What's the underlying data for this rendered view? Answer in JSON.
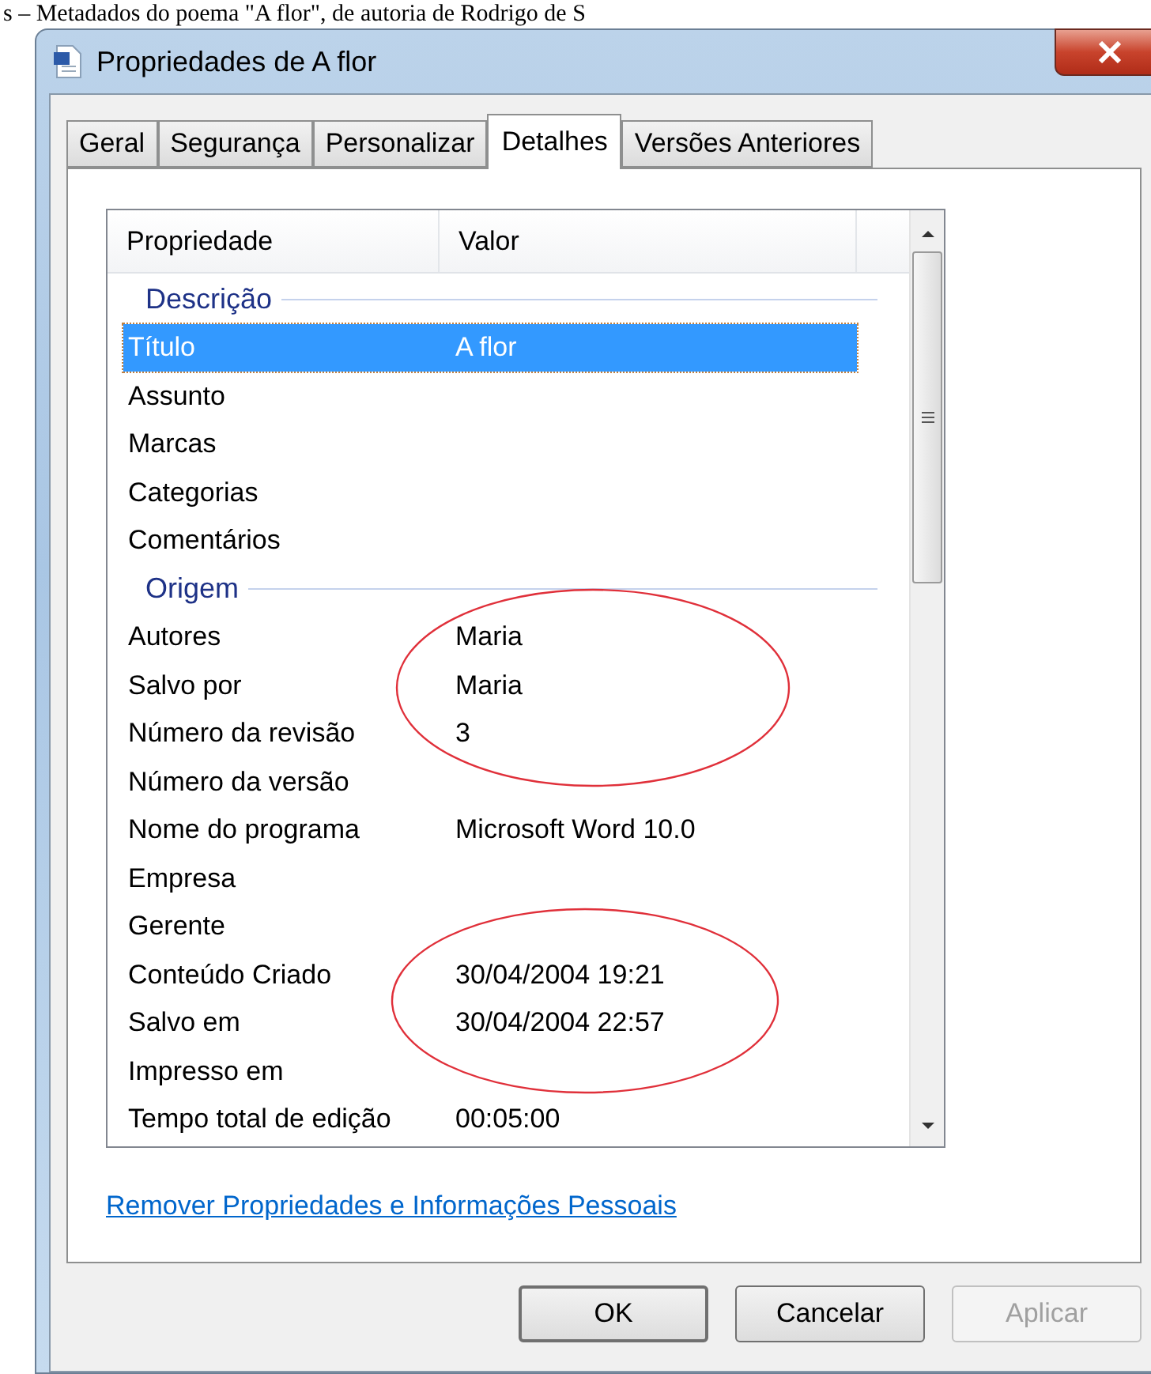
{
  "caption": "s – Metadados do poema \"A flor\", de autoria de Rodrigo de S",
  "window": {
    "title": "Propriedades de A flor"
  },
  "tabs": [
    {
      "label": "Geral",
      "selected": false
    },
    {
      "label": "Segurança",
      "selected": false
    },
    {
      "label": "Personalizar",
      "selected": false
    },
    {
      "label": "Detalhes",
      "selected": true
    },
    {
      "label": "Versões Anteriores",
      "selected": false
    }
  ],
  "table": {
    "columns": [
      "Propriedade",
      "Valor"
    ],
    "rows": [
      {
        "kind": "group",
        "label": "Descrição"
      },
      {
        "kind": "row",
        "property": "Título",
        "value": "A flor",
        "selected": true
      },
      {
        "kind": "row",
        "property": "Assunto",
        "selected": false
      },
      {
        "kind": "row",
        "property": "Marcas",
        "selected": false
      },
      {
        "kind": "row",
        "property": "Categorias",
        "selected": false
      },
      {
        "kind": "row",
        "property": "Comentários",
        "selected": false
      },
      {
        "kind": "group",
        "label": "Origem"
      },
      {
        "kind": "row",
        "property": "Autores",
        "value": "Maria",
        "selected": false
      },
      {
        "kind": "row",
        "property": "Salvo por",
        "value": "Maria",
        "selected": false
      },
      {
        "kind": "row",
        "property": "Número da revisão",
        "value": "3",
        "selected": false
      },
      {
        "kind": "row",
        "property": "Número da versão",
        "selected": false
      },
      {
        "kind": "row",
        "property": "Nome do programa",
        "value": "Microsoft Word 10.0",
        "selected": false
      },
      {
        "kind": "row",
        "property": "Empresa",
        "selected": false
      },
      {
        "kind": "row",
        "property": "Gerente",
        "selected": false
      },
      {
        "kind": "row",
        "property": "Conteúdo Criado",
        "value": "30/04/2004 19:21",
        "selected": false
      },
      {
        "kind": "row",
        "property": "Salvo em",
        "value": "30/04/2004 22:57",
        "selected": false
      },
      {
        "kind": "row",
        "property": "Impresso em",
        "selected": false
      },
      {
        "kind": "row",
        "property": "Tempo total de edição",
        "value": "00:05:00",
        "selected": false
      }
    ]
  },
  "link": "Remover Propriedades e Informações Pessoais",
  "buttons": [
    {
      "label": "OK",
      "kind": "default",
      "disabled": false
    },
    {
      "label": "Cancelar",
      "kind": "normal",
      "disabled": false
    },
    {
      "label": "Aplicar",
      "kind": "normal",
      "disabled": true
    }
  ]
}
